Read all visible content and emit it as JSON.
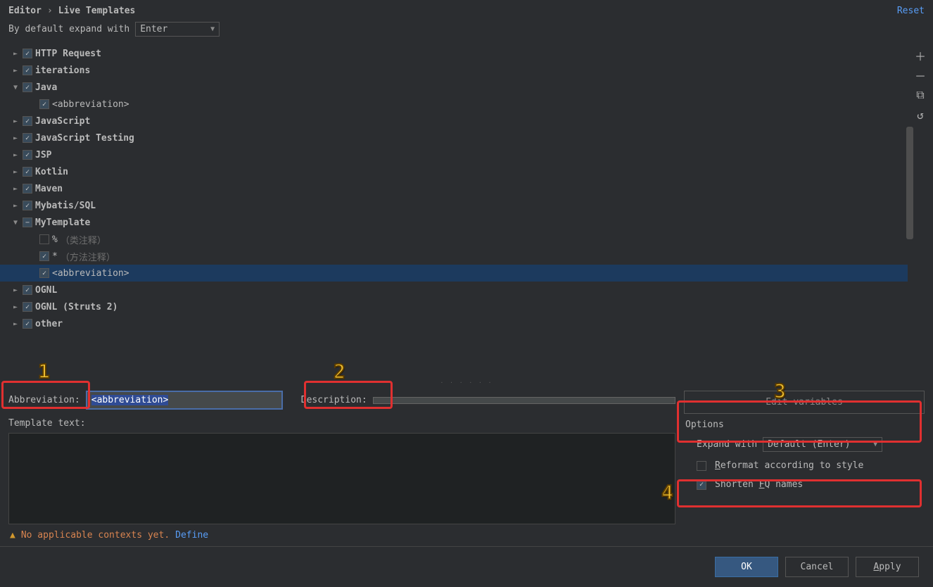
{
  "breadcrumb": {
    "a": "Editor",
    "b": "Live Templates",
    "reset": "Reset"
  },
  "defaultRow": {
    "label": "By default expand with",
    "value": "Enter"
  },
  "tree": [
    {
      "indent": 0,
      "exp": "►",
      "chk": "on",
      "label": "HTTP Request",
      "bold": true
    },
    {
      "indent": 0,
      "exp": "►",
      "chk": "on",
      "label": "iterations",
      "bold": true
    },
    {
      "indent": 0,
      "exp": "▼",
      "chk": "on",
      "label": "Java",
      "bold": true
    },
    {
      "indent": 1,
      "exp": "",
      "chk": "on",
      "label": "<abbreviation>"
    },
    {
      "indent": 0,
      "exp": "►",
      "chk": "on",
      "label": "JavaScript",
      "bold": true
    },
    {
      "indent": 0,
      "exp": "►",
      "chk": "on",
      "label": "JavaScript Testing",
      "bold": true
    },
    {
      "indent": 0,
      "exp": "►",
      "chk": "on",
      "label": "JSP",
      "bold": true
    },
    {
      "indent": 0,
      "exp": "►",
      "chk": "on",
      "label": "Kotlin",
      "bold": true
    },
    {
      "indent": 0,
      "exp": "►",
      "chk": "on",
      "label": "Maven",
      "bold": true
    },
    {
      "indent": 0,
      "exp": "►",
      "chk": "on",
      "label": "Mybatis/SQL",
      "bold": true
    },
    {
      "indent": 0,
      "exp": "▼",
      "chk": "ind",
      "label": "MyTemplate",
      "bold": true
    },
    {
      "indent": 1,
      "exp": "",
      "chk": "off",
      "label": "%",
      "hint": "（类注释）"
    },
    {
      "indent": 1,
      "exp": "",
      "chk": "on",
      "label": "*",
      "hint": "（方法注释）"
    },
    {
      "indent": 1,
      "exp": "",
      "chk": "on",
      "label": "<abbreviation>",
      "selected": true
    },
    {
      "indent": 0,
      "exp": "►",
      "chk": "on",
      "label": "OGNL",
      "bold": true
    },
    {
      "indent": 0,
      "exp": "►",
      "chk": "on",
      "label": "OGNL (Struts 2)",
      "bold": true
    },
    {
      "indent": 0,
      "exp": "►",
      "chk": "on",
      "label": "other",
      "bold": true
    }
  ],
  "sideTools": {
    "plus": "＋",
    "minus": "－",
    "copy": "⧉",
    "undo": "↺"
  },
  "fields": {
    "abbrev_label": "Abbreviation:",
    "abbrev_value": "<abbreviation>",
    "desc_label": "Description:",
    "desc_value": "",
    "template_label": "Template text:"
  },
  "right": {
    "edit_vars": "Edit variables",
    "options": "Options",
    "expand_label": "Expand with",
    "expand_value": "Default (Enter)",
    "reformat": "Reformat according to style",
    "reformat_u": "R",
    "shorten": "Shorten FQ names",
    "shorten_u": "F"
  },
  "warning": {
    "icon": "▲",
    "text": "No applicable contexts yet.",
    "define": "Define"
  },
  "buttons": {
    "ok": "OK",
    "cancel": "Cancel",
    "apply": "Apply"
  },
  "annotations": {
    "n1": "1",
    "n2": "2",
    "n3": "3",
    "n4": "4"
  }
}
